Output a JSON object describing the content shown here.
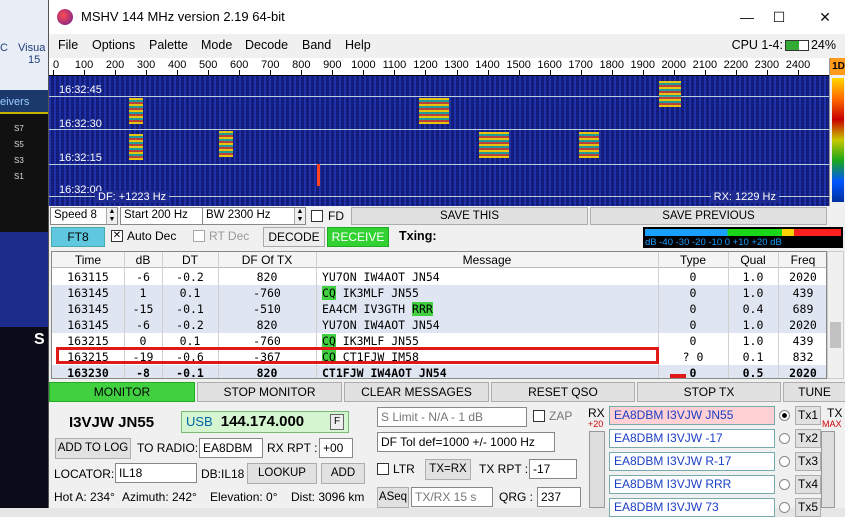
{
  "background": {
    "left_labels": [
      "C",
      "Visua",
      "15",
      "eivers",
      "S7",
      "S5",
      "S3",
      "S1",
      "S"
    ]
  },
  "window": {
    "title": "MSHV 144 MHz version 2.19 64-bit",
    "controls": {
      "minimize": "—",
      "maximize": "☐",
      "close": "✕"
    }
  },
  "menu": {
    "items": [
      "File",
      "Options",
      "Palette",
      "Mode",
      "Decode",
      "Band",
      "Help"
    ],
    "cpu_label": "CPU 1-4:",
    "cpu_value": "24%"
  },
  "ruler": {
    "ticks": [
      "0",
      "100",
      "200",
      "300",
      "400",
      "500",
      "600",
      "700",
      "800",
      "900",
      "1000",
      "1100",
      "1200",
      "1300",
      "1400",
      "1500",
      "1600",
      "1700",
      "1800",
      "1900",
      "2000",
      "2100",
      "2200",
      "2300",
      "2400"
    ],
    "max": 2500
  },
  "waterfall": {
    "times": [
      "16:32:45",
      "16:32:30",
      "16:32:15",
      "16:32:00"
    ],
    "df_label": "DF: +1223 Hz",
    "rx_label": "RX: 1229 Hz",
    "side_button": "1D"
  },
  "controls": {
    "speed": "Speed 8",
    "start": "Start 200 Hz",
    "bw": "BW 2300 Hz",
    "fd_label": "FD",
    "save_this": "SAVE THIS",
    "save_previous": "SAVE PREVIOUS"
  },
  "mode_row": {
    "mode": "FT8",
    "auto_dec": "Auto Dec",
    "rt_dec": "RT Dec",
    "decode": "DECODE",
    "receive": "RECEIVE",
    "txing": "Txing:",
    "meter_scale": "dB  -40  -30  -20  -10    0   +10  +20 dB"
  },
  "table": {
    "headers": [
      "Time",
      "dB",
      "DT",
      "DF Of TX",
      "Message",
      "Type",
      "Qual",
      "Freq"
    ],
    "rows": [
      {
        "time": "163115",
        "db": "-6",
        "dt": "-0.2",
        "df": "820",
        "msg_cq": "",
        "msg": "YU7ON IW4AOT JN54",
        "msg_rrr": "",
        "type": "0",
        "qual": "1.0",
        "freq": "2020",
        "shade": false
      },
      {
        "time": "163145",
        "db": "1",
        "dt": "0.1",
        "df": "-760",
        "msg_cq": "CQ",
        "msg": " IK3MLF JN55",
        "msg_rrr": "",
        "type": "0",
        "qual": "1.0",
        "freq": "439",
        "shade": true
      },
      {
        "time": "163145",
        "db": "-15",
        "dt": "-0.1",
        "df": "-510",
        "msg_cq": "",
        "msg": "EA4CM IV3GTH ",
        "msg_rrr": "RRR",
        "type": "0",
        "qual": "0.4",
        "freq": "689",
        "shade": true
      },
      {
        "time": "163145",
        "db": "-6",
        "dt": "-0.2",
        "df": "820",
        "msg_cq": "",
        "msg": "YU7ON IW4AOT JN54",
        "msg_rrr": "",
        "type": "0",
        "qual": "1.0",
        "freq": "2020",
        "shade": true
      },
      {
        "time": "163215",
        "db": "0",
        "dt": "0.1",
        "df": "-760",
        "msg_cq": "CQ",
        "msg": " IK3MLF JN55",
        "msg_rrr": "",
        "type": "0",
        "qual": "1.0",
        "freq": "439",
        "shade": false
      },
      {
        "time": "163215",
        "db": "-19",
        "dt": "-0.6",
        "df": "-367",
        "msg_cq": "CQ",
        "msg": " CT1FJW IM58",
        "msg_rrr": "",
        "type": "? 0",
        "qual": "0.1",
        "freq": "832",
        "shade": false
      },
      {
        "time": "163230",
        "db": "-8",
        "dt": "-0.1",
        "df": "820",
        "msg_cq": "",
        "msg": "CT1FJW IW4AOT JN54",
        "msg_rrr": "",
        "type": "0",
        "qual": "0.5",
        "freq": "2020",
        "shade": true
      }
    ]
  },
  "commands": [
    "MONITOR",
    "STOP MONITOR",
    "CLEAR MESSAGES",
    "RESET QSO",
    "STOP TX",
    "TUNE"
  ],
  "station": {
    "call_locator": "I3VJW JN55",
    "mode": "USB",
    "frequency": "144.174.000",
    "f_button": "F",
    "add_to_log": "ADD TO LOG",
    "to_radio_label": "TO RADIO:",
    "to_radio_value": "EA8DBM",
    "rx_rpt_label": "RX RPT :",
    "rx_rpt_value": "+00",
    "locator_label": "LOCATOR:",
    "locator_value": "IL18",
    "db_locator": "DB:IL18",
    "lookup": "LOOKUP",
    "add": "ADD",
    "hot_a": "Hot A: 234°",
    "azimuth": "Azimuth: 242°",
    "elevation": "Elevation: 0°",
    "dist": "Dist: 3096 km"
  },
  "options": {
    "s_limit": "S Limit - N/A - 1  dB",
    "zap": "ZAP",
    "df_tol": "DF Tol def=1000 +/-  1000  Hz",
    "ltr": "LTR",
    "tx_rx": "TX=RX",
    "tx_rpt_label": "TX RPT :",
    "tx_rpt_value": "-17",
    "aseq": "ASeq",
    "txrx_period": "TX/RX 15  s",
    "qrg_label": "QRG :",
    "qrg_value": "237"
  },
  "levels": {
    "rx_label": "RX",
    "rx_value": "+20",
    "tx_label": "TX",
    "tx_value": "MAX"
  },
  "macros": [
    {
      "text": "EA8DBM I3VJW JN55",
      "tx": "Tx1",
      "selected": true
    },
    {
      "text": "EA8DBM I3VJW -17",
      "tx": "Tx2",
      "selected": false
    },
    {
      "text": "EA8DBM I3VJW R-17",
      "tx": "Tx3",
      "selected": false
    },
    {
      "text": "EA8DBM I3VJW RRR",
      "tx": "Tx4",
      "selected": false
    },
    {
      "text": "EA8DBM I3VJW 73",
      "tx": "Tx5",
      "selected": false
    }
  ]
}
